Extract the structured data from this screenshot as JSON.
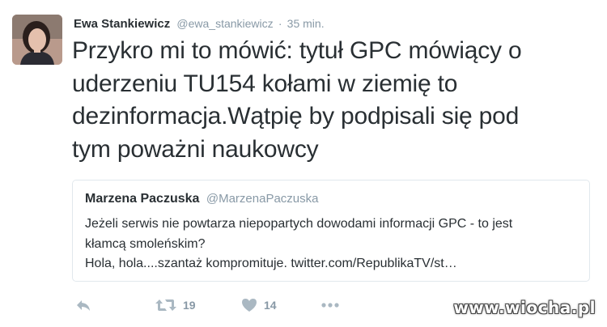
{
  "tweet": {
    "author_name": "Ewa Stankiewicz",
    "author_handle": "@ewa_stankiewicz",
    "separator": "·",
    "time": "35 min.",
    "text_lines": [
      "Przykro mi to mówić: tytuł GPC mówiący o",
      "uderzeniu TU154 kołami w ziemię to",
      "dezinformacja.Wątpię by podpisali się pod",
      "tym poważni naukowcy"
    ]
  },
  "quoted_tweet": {
    "author_name": "Marzena Paczuska",
    "author_handle": "@MarzenaPaczuska",
    "text_lines": [
      "Jeżeli serwis nie powtarza niepopartych dowodami  informacji GPC - to jest",
      "kłamcą smoleńskim?",
      "Hola, hola....szantaż kompromituje. twitter.com/RepublikaTV/st…"
    ]
  },
  "actions": {
    "reply_icon": "reply-icon",
    "retweet_icon": "retweet-icon",
    "retweet_count": "19",
    "like_icon": "heart-icon",
    "like_count": "14",
    "more_icon": "more-icon"
  },
  "watermark": "www.wiocha.pl",
  "colors": {
    "text": "#292f33",
    "secondary": "#8899a6",
    "border": "#e1e8ed",
    "icon": "#aab8c2"
  }
}
